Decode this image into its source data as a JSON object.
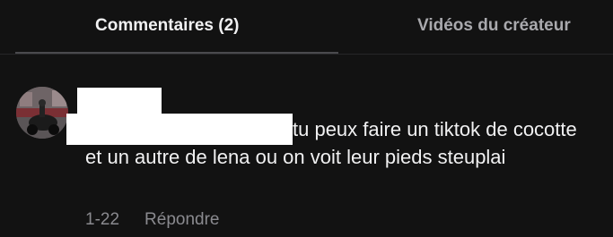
{
  "tabs": {
    "comments_label": "Commentaires (2)",
    "videos_label": "Vidéos du créateur",
    "active": "comments"
  },
  "comment": {
    "text": "tu peux faire un tiktok de cocotte et un autre de lena ou on voit leur pieds steuplai",
    "date": "1-22",
    "reply_label": "Répondre"
  },
  "colors": {
    "background": "#121212",
    "text_primary": "#f1f1f2",
    "text_secondary": "#8a8a8f",
    "tab_inactive": "#a9a9ad",
    "redaction": "#ffffff"
  },
  "icons": {
    "avatar": "user-avatar-photo"
  }
}
